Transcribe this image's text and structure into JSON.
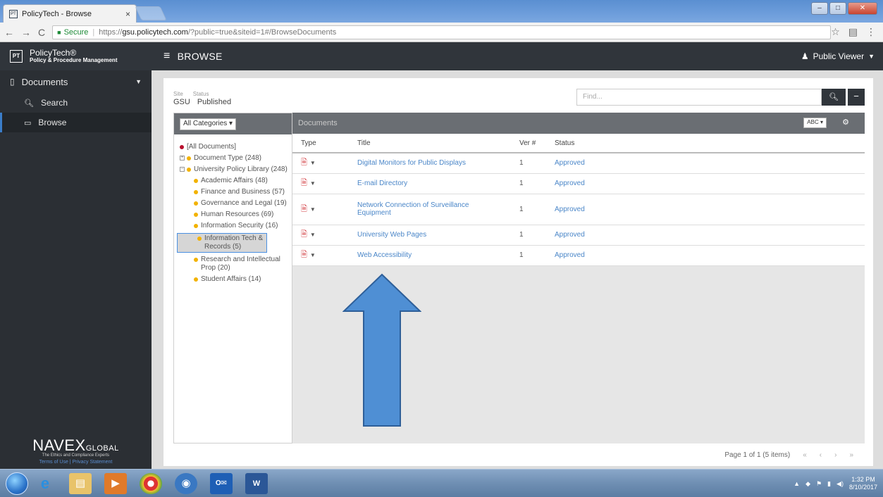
{
  "browser": {
    "tab_title": "PolicyTech - Browse",
    "tab_favicon": "PT",
    "secure_label": "Secure",
    "url_scheme": "https://",
    "url_host": "gsu.policytech.com",
    "url_path": "/?public=true&siteid=1#/BrowseDocuments"
  },
  "header": {
    "brand_logo": "PT",
    "brand_name": "PolicyTech®",
    "brand_sub": "Policy & Procedure Management",
    "title": "BROWSE",
    "user": "Public Viewer"
  },
  "sidebar": {
    "documents_label": "Documents",
    "items": [
      {
        "label": "Search",
        "icon": "search-icon"
      },
      {
        "label": "Browse",
        "icon": "folder-icon"
      }
    ],
    "footer_logo_main": "NAVEX",
    "footer_logo_sub": "GLOBAL",
    "footer_tagline": "The Ethics and Compliance Experts",
    "footer_terms": "Terms of Use",
    "footer_privacy": "Privacy Statement"
  },
  "filters": {
    "site_label": "Site",
    "status_label": "Status",
    "site_value": "GSU",
    "status_value": "Published",
    "find_placeholder": "Find..."
  },
  "categories": {
    "dropdown_label": "All Categories",
    "tree": {
      "all": "[All Documents]",
      "doc_type": "Document Type (248)",
      "library": "University Policy Library (248)",
      "children": [
        "Academic Affairs (48)",
        "Finance and Business (57)",
        "Governance and Legal (19)",
        "Human Resources (69)",
        "Information Security (16)",
        "Information Tech & Records (5)",
        "Research and Intellectual Prop (20)",
        "Student Affairs (14)"
      ]
    }
  },
  "documents": {
    "panel_title": "Documents",
    "sort_label": "ABC",
    "columns": [
      "Type",
      "Title",
      "Ver #",
      "Status"
    ],
    "rows": [
      {
        "title": "Digital Monitors for Public Displays",
        "ver": "1",
        "status": "Approved"
      },
      {
        "title": "E-mail Directory",
        "ver": "1",
        "status": "Approved"
      },
      {
        "title": "Network Connection of Surveillance Equipment",
        "ver": "1",
        "status": "Approved"
      },
      {
        "title": "University Web Pages",
        "ver": "1",
        "status": "Approved"
      },
      {
        "title": "Web Accessibility",
        "ver": "1",
        "status": "Approved"
      }
    ],
    "pager_text": "Page 1 of 1 (5 items)"
  },
  "taskbar": {
    "time": "1:32 PM",
    "date": "8/10/2017"
  },
  "colors": {
    "header_bg": "#30353b",
    "link": "#4a86c8",
    "arrow": "#4f8fd4"
  }
}
